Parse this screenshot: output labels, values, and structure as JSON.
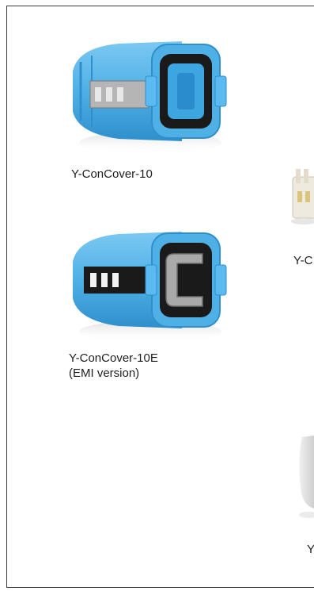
{
  "products": [
    {
      "caption_lines": [
        "Y-ConCover-10"
      ]
    },
    {
      "caption_lines": [
        "Y-ConCover-10E",
        "(EMI version)"
      ]
    }
  ],
  "cropped_captions": [
    "Y-C",
    "Y"
  ],
  "colors": {
    "cover_blue": "#4fb0e6",
    "cover_blue_dark": "#2f8fcc",
    "insert_black": "#1a1a1a",
    "metal": "#a9a9a9",
    "frame": "#3a3a3a"
  }
}
